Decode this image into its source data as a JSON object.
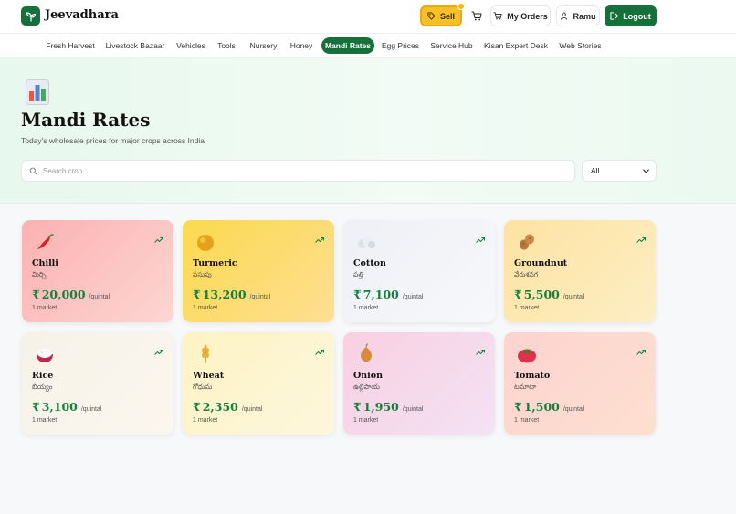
{
  "header": {
    "brand": "Jeevadhara",
    "sell_label": "Sell",
    "orders_label": "My Orders",
    "user_label": "Ramu",
    "logout_label": "Logout"
  },
  "nav": {
    "items": [
      "Fresh Harvest",
      "Livestock Bazaar",
      "Vehicles",
      "Tools",
      "Nursery",
      "Honey",
      "Mandi Rates",
      "Egg Prices",
      "Service Hub",
      "Kisan Expert Desk",
      "Web Stories"
    ],
    "active": "Mandi Rates"
  },
  "hero": {
    "title": "Mandi Rates",
    "subtitle": "Today's wholesale prices for major crops across India",
    "search_placeholder": "Search crop...",
    "filter_value": "All"
  },
  "cards": [
    {
      "en": "Chilli",
      "te": "మిర్చి",
      "currency": "₹",
      "price": "20,000",
      "unit": "/quintal",
      "markets": "1 market",
      "icon": "chilli-icon"
    },
    {
      "en": "Turmeric",
      "te": "పసుపు",
      "currency": "₹",
      "price": "13,200",
      "unit": "/quintal",
      "markets": "1 market",
      "icon": "turmeric-icon"
    },
    {
      "en": "Cotton",
      "te": "పత్తి",
      "currency": "₹",
      "price": "7,100",
      "unit": "/quintal",
      "markets": "1 market",
      "icon": "cotton-icon"
    },
    {
      "en": "Groundnut",
      "te": "వేరుశనగ",
      "currency": "₹",
      "price": "5,500",
      "unit": "/quintal",
      "markets": "1 market",
      "icon": "groundnut-icon"
    },
    {
      "en": "Rice",
      "te": "బియ్యం",
      "currency": "₹",
      "price": "3,100",
      "unit": "/quintal",
      "markets": "1 market",
      "icon": "rice-icon"
    },
    {
      "en": "Wheat",
      "te": "గోధుమ",
      "currency": "₹",
      "price": "2,350",
      "unit": "/quintal",
      "markets": "1 market",
      "icon": "wheat-icon"
    },
    {
      "en": "Onion",
      "te": "ఉల్లిపాయ",
      "currency": "₹",
      "price": "1,950",
      "unit": "/quintal",
      "markets": "1 market",
      "icon": "onion-icon"
    },
    {
      "en": "Tomato",
      "te": "టమాటా",
      "currency": "₹",
      "price": "1,500",
      "unit": "/quintal",
      "markets": "1 market",
      "icon": "tomato-icon"
    }
  ],
  "colors": {
    "brand_green": "#16703a",
    "sell_yellow": "#f6c026",
    "price_green": "#15803d"
  }
}
